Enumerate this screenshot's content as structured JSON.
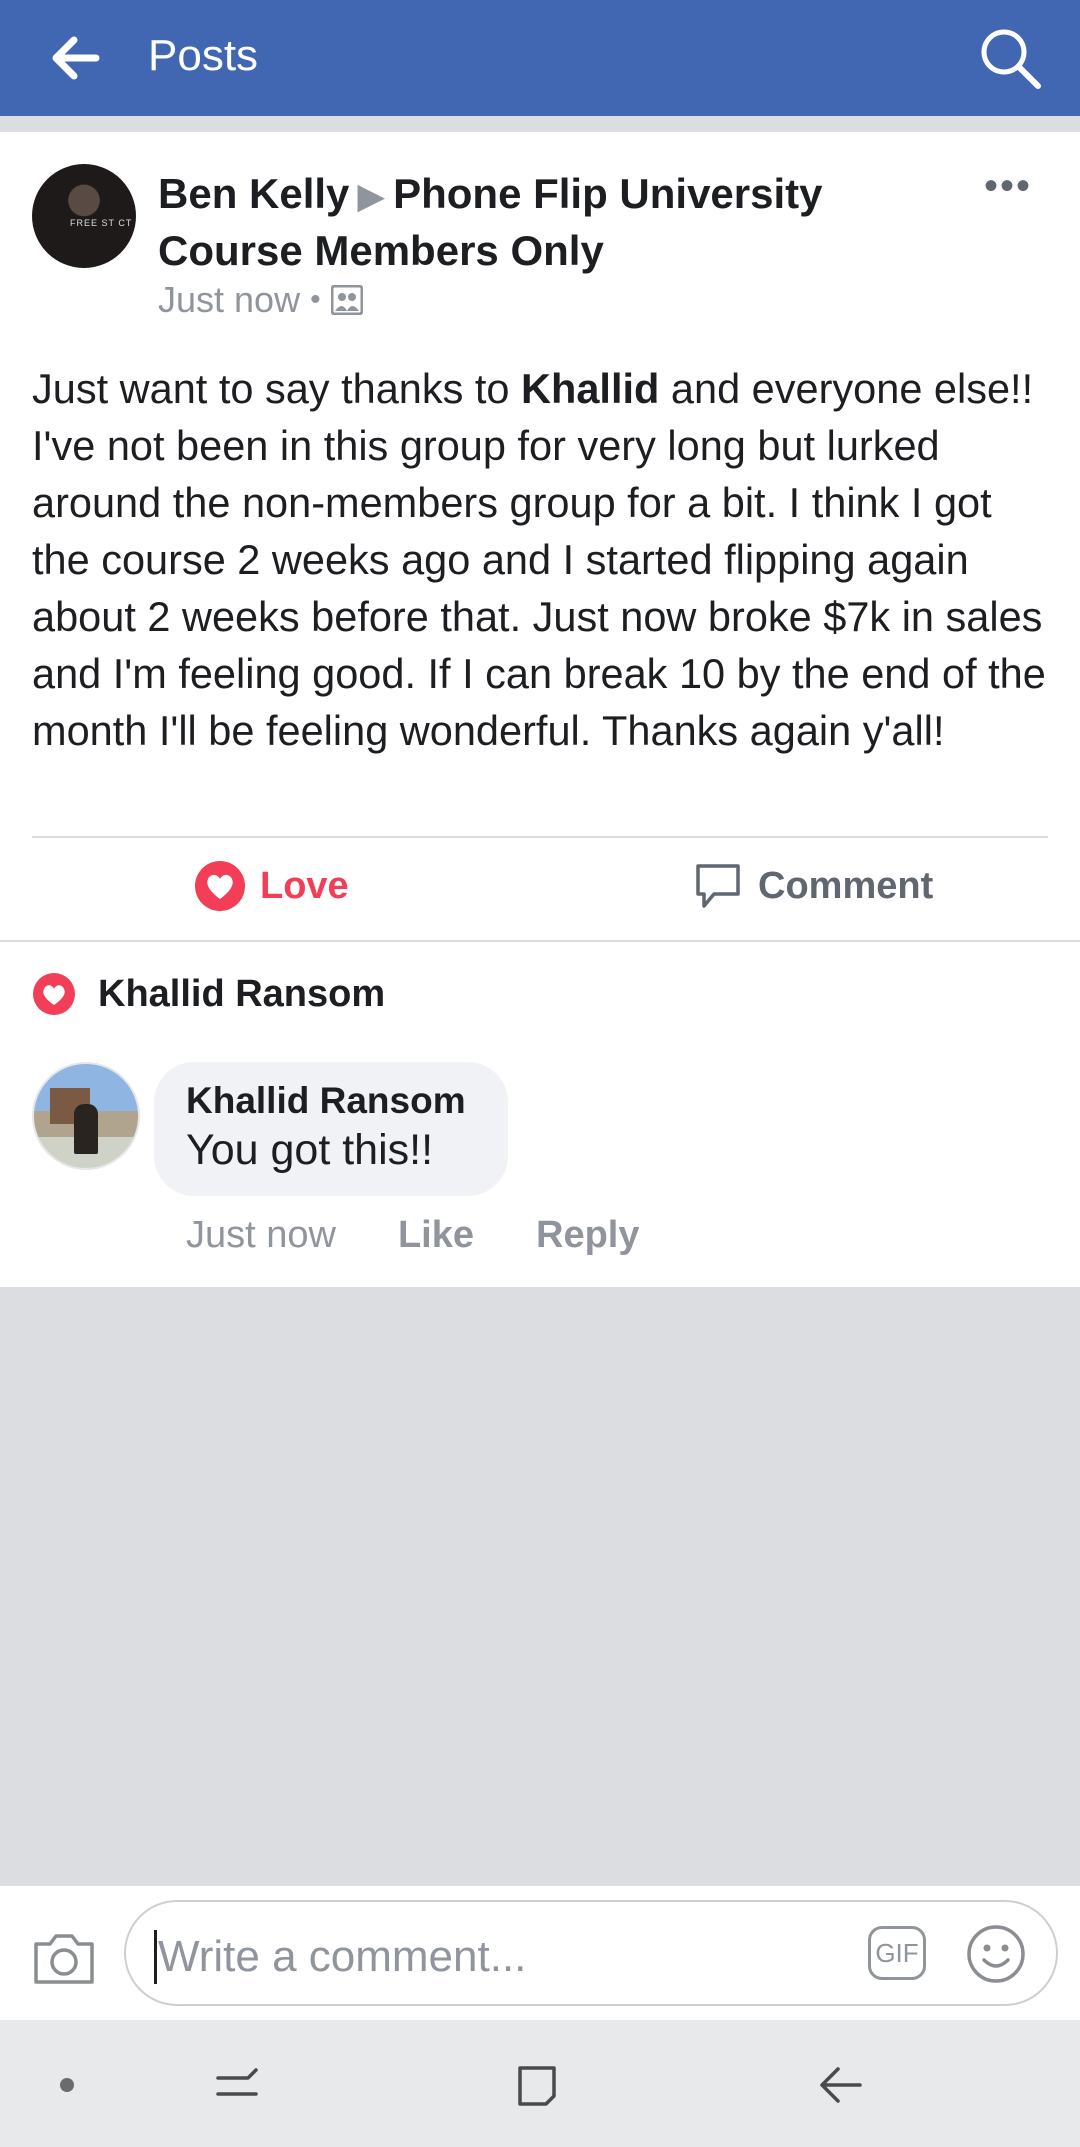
{
  "header": {
    "title": "Posts",
    "back_icon": "arrow-left-icon",
    "search_icon": "search-icon",
    "bg": "#4267b2"
  },
  "post": {
    "author": "Ben Kelly",
    "group": "Phone Flip University Course Members Only",
    "time": "Just now",
    "audience_icon": "group-icon",
    "text_before": "Just want to say thanks to ",
    "text_bold": "Khallid",
    "text_after": " and everyone else!! I've not been in this group for very long but lurked around the non-members group for a bit. I think I got the course 2 weeks ago and I started flipping again about 2 weeks before that. Just now broke $7k in sales and I'm feeling good. If I can break 10 by the end of the month I'll be feeling wonderful. Thanks again y'all!",
    "avatar_shirt_text": "FREE ST  CT"
  },
  "actions": {
    "love_label": "Love",
    "comment_label": "Comment",
    "love_color": "#f33e58"
  },
  "reactions": {
    "name": "Khallid Ransom"
  },
  "comment": {
    "author": "Khallid Ransom",
    "text": "You got this!!",
    "time": "Just now",
    "like_label": "Like",
    "reply_label": "Reply"
  },
  "composer": {
    "placeholder": "Write a comment...",
    "gif_label": "GIF"
  }
}
